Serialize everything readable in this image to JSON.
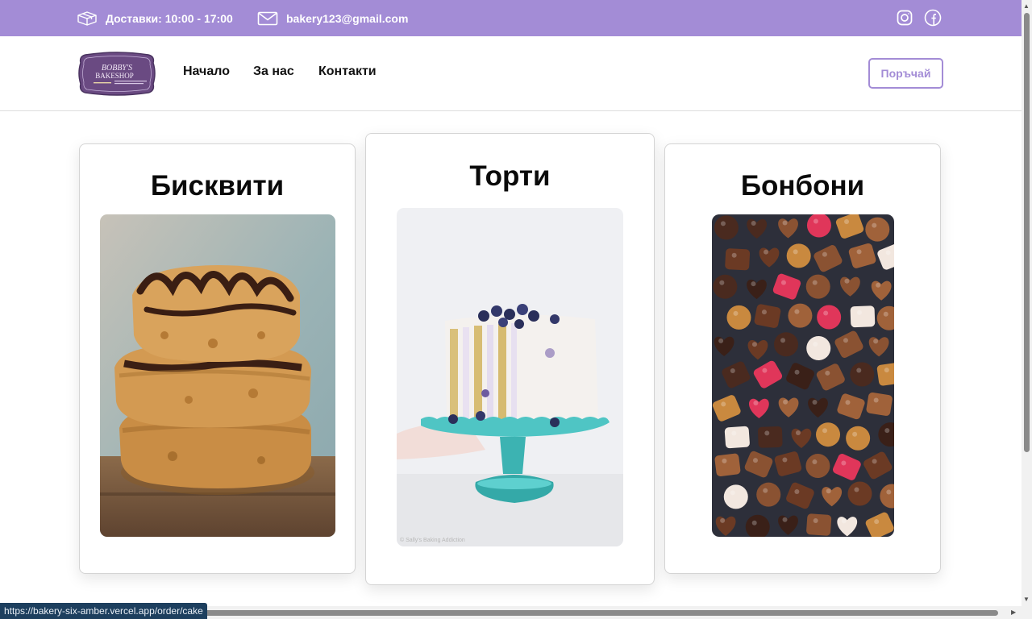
{
  "topbar": {
    "delivery_text": "Доставки: 10:00 - 17:00",
    "email": "bakery123@gmail.com",
    "background": "#a38cd6",
    "delivery_icon": "box-icon",
    "email_icon": "mail-icon",
    "social": [
      "instagram-icon",
      "facebook-icon"
    ]
  },
  "navbar": {
    "logo": {
      "line1": "BOBBY'S",
      "line2": "BAKESHOP",
      "background": "#6a4a82"
    },
    "links": [
      "Начало",
      "За нас",
      "Контакти"
    ],
    "order_label": "Поръчай",
    "accent": "#a38cd6"
  },
  "cards": [
    {
      "title": "Бисквити",
      "image": "stacked oat cookies with chocolate drizzle"
    },
    {
      "title": "Торти",
      "image": "blueberry layer cake on teal cake stand",
      "watermark": "© Sally's Baking Addiction"
    },
    {
      "title": "Бонбони",
      "image": "assorted chocolate bonbons"
    }
  ],
  "status_bar": {
    "url": "https://bakery-six-amber.vercel.app/order/cake"
  }
}
